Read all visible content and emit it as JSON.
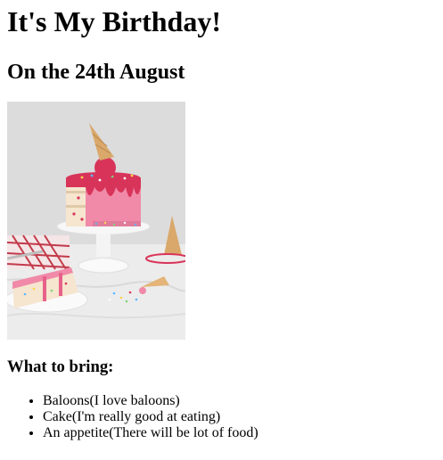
{
  "page": {
    "title": "It's My Birthday!",
    "date_heading": "On the 24th August",
    "image_alt": "Pink drip birthday cake with sprinkles and an ice cream cone on top",
    "bring_heading": "What to bring:",
    "bring_items": [
      "Baloons(I love baloons)",
      "Cake(I'm really good at eating)",
      "An appetite(There will be lot of food)"
    ]
  },
  "colors": {
    "cake_pink": "#e8618a",
    "drip_red": "#d8345a",
    "cone": "#d9a86a",
    "backdrop": "#dcdcdc"
  }
}
